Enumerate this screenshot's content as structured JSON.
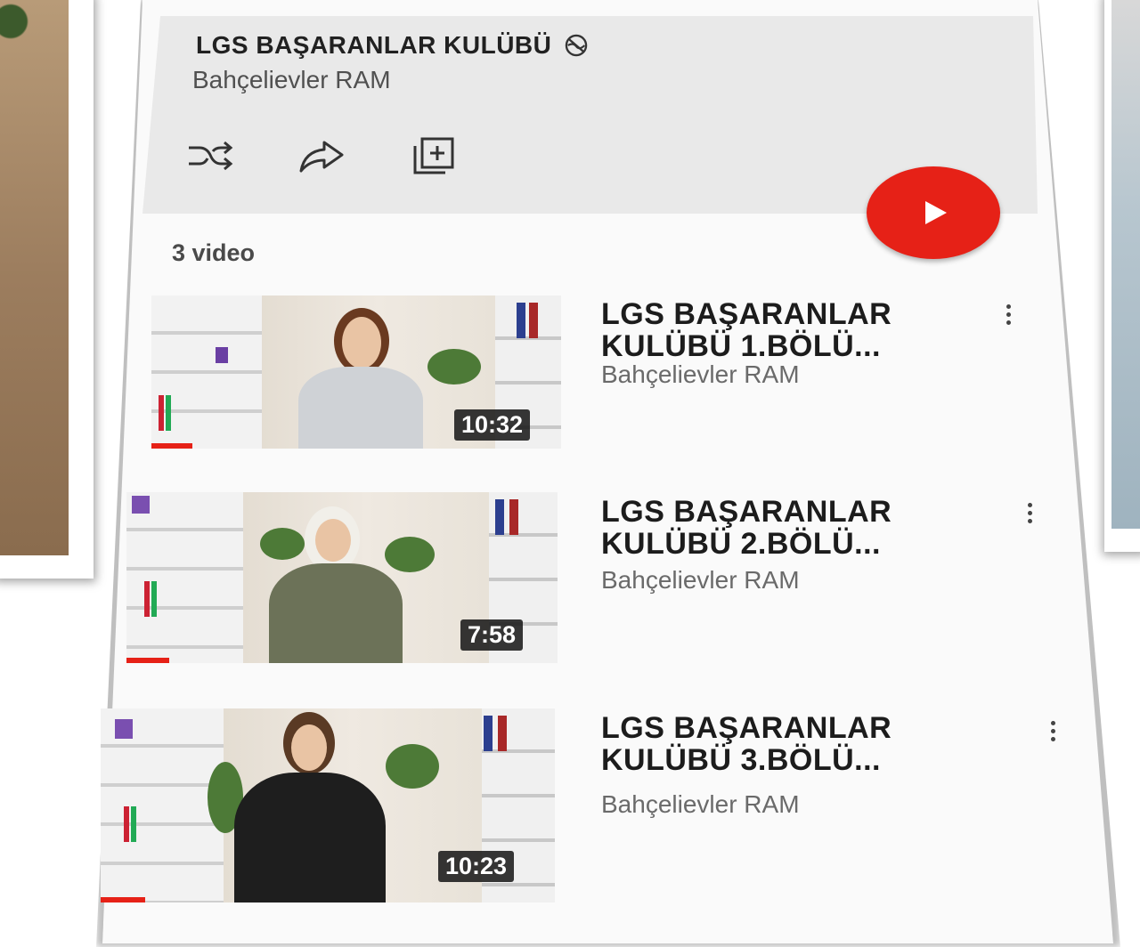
{
  "playlist": {
    "title": "LGS BAŞARANLAR KULÜBÜ",
    "owner": "Bahçelievler RAM",
    "video_count": "3 video",
    "actions": [
      "shuffle-icon",
      "share-icon",
      "add-to-library-icon"
    ],
    "accent": "#e62117"
  },
  "videos": [
    {
      "title_line1": "LGS BAŞARANLAR",
      "title_line2": "KULÜBÜ 1.BÖLÜ...",
      "channel": "Bahçelievler RAM",
      "duration": "10:32"
    },
    {
      "title_line1": "LGS BAŞARANLAR",
      "title_line2": "KULÜBÜ 2.BÖLÜ...",
      "channel": "Bahçelievler RAM",
      "duration": "7:58"
    },
    {
      "title_line1": "LGS BAŞARANLAR",
      "title_line2": "KULÜBÜ 3.BÖLÜ...",
      "channel": "Bahçelievler RAM",
      "duration": "10:23"
    }
  ]
}
